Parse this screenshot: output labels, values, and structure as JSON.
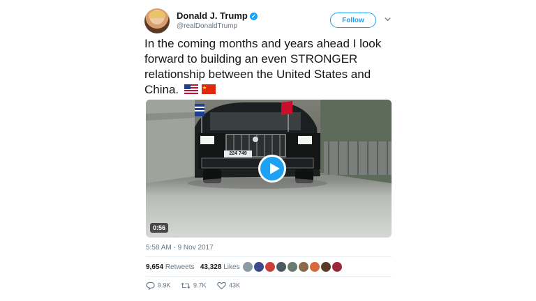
{
  "author": {
    "name": "Donald J. Trump",
    "handle": "@realDonaldTrump",
    "verified_glyph": "✓"
  },
  "follow_label": "Follow",
  "tweet_text": "In the coming months and years ahead I look forward to building an even STRONGER relationship between the United States and China.",
  "video": {
    "duration": "0:56",
    "plate": "224 749"
  },
  "timestamp": "5:58 AM - 9 Nov 2017",
  "stats": {
    "retweets_count": "9,654",
    "retweets_label": "Retweets",
    "likes_count": "43,328",
    "likes_label": "Likes"
  },
  "actions": {
    "replies": "9.9K",
    "retweets": "9.7K",
    "likes": "43K"
  },
  "colors": {
    "accent": "#1da1f2",
    "muted": "#657786"
  }
}
